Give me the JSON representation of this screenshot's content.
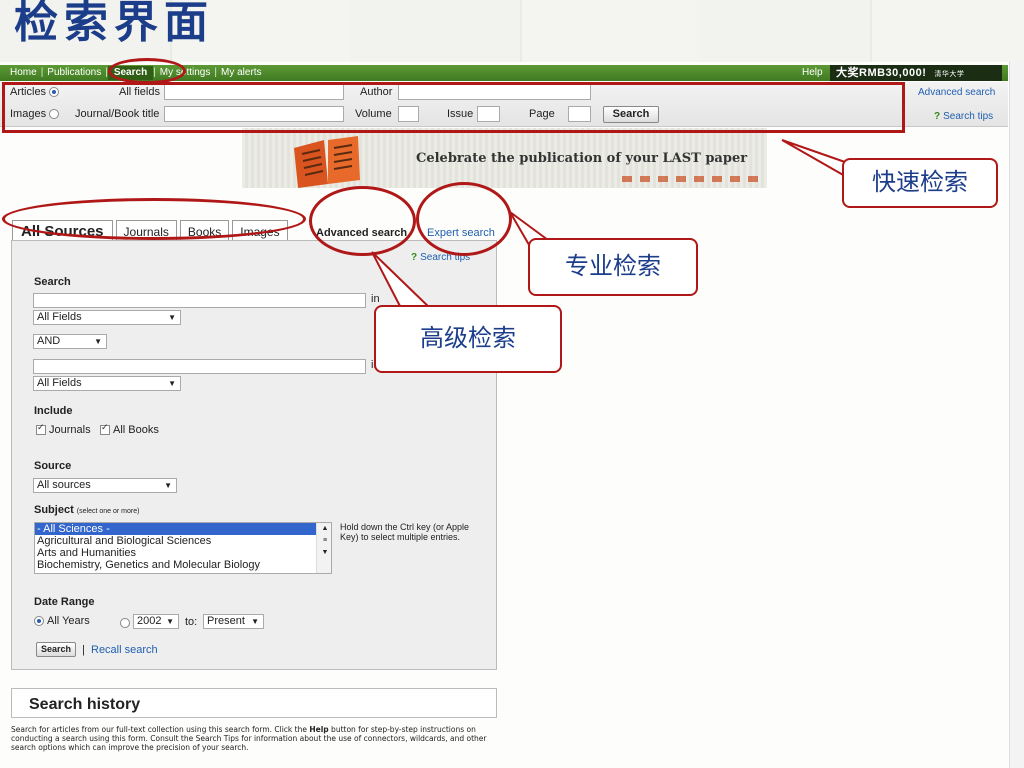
{
  "slide": {
    "title": "检索界面"
  },
  "nav": {
    "items": [
      "Home",
      "Publications",
      "Search",
      "My settings",
      "My alerts"
    ],
    "help": "Help",
    "promo": "大奖RMB30,000!",
    "promo_small": "清华大学"
  },
  "quick": {
    "articles_label": "Articles",
    "images_label": "Images",
    "all_fields_label": "All fields",
    "journal_label": "Journal/Book title",
    "author_label": "Author",
    "volume_label": "Volume",
    "issue_label": "Issue",
    "page_label": "Page",
    "search_button": "Search",
    "advanced_link": "Advanced search",
    "tips_link": "Search tips"
  },
  "banner": {
    "text": "Celebrate the publication of your LAST paper"
  },
  "tabs": {
    "items": [
      "All Sources",
      "Journals",
      "Books",
      "Images"
    ],
    "advanced": "Advanced search",
    "expert": "Expert search"
  },
  "form": {
    "tips": "Search tips",
    "search_label": "Search",
    "in_label": "in",
    "field1": "All Fields",
    "operator": "AND",
    "field2": "All Fields",
    "include_label": "Include",
    "include_journals": "Journals",
    "include_books": "All Books",
    "source_label": "Source",
    "source_value": "All sources",
    "subject_label": "Subject",
    "subject_hint": "(select one or more)",
    "subjects": [
      "- All Sciences -",
      "Agricultural and Biological Sciences",
      "Arts and Humanities",
      "Biochemistry, Genetics and Molecular Biology"
    ],
    "ctrl_hint": "Hold down the Ctrl key (or Apple Key) to select multiple entries.",
    "date_label": "Date Range",
    "all_years": "All Years",
    "year_from": "2002",
    "to_label": "to:",
    "year_to": "Present",
    "search_button": "Search",
    "recall": "Recall search"
  },
  "history": {
    "title": "Search history",
    "desc_pre": "Search for articles from our full-text collection using this search form. Click the ",
    "desc_help": "Help",
    "desc_post": " button for step-by-step instructions on conducting a search using this form. Consult the Search Tips for information about the use of connectors, wildcards, and other search options which can improve the precision of your search."
  },
  "callouts": {
    "quick": "快速检索",
    "expert": "专业检索",
    "advanced": "高级检索"
  },
  "colors": {
    "accent": "#b01818",
    "nav": "#4a8a2a",
    "title": "#1c3d8a"
  }
}
